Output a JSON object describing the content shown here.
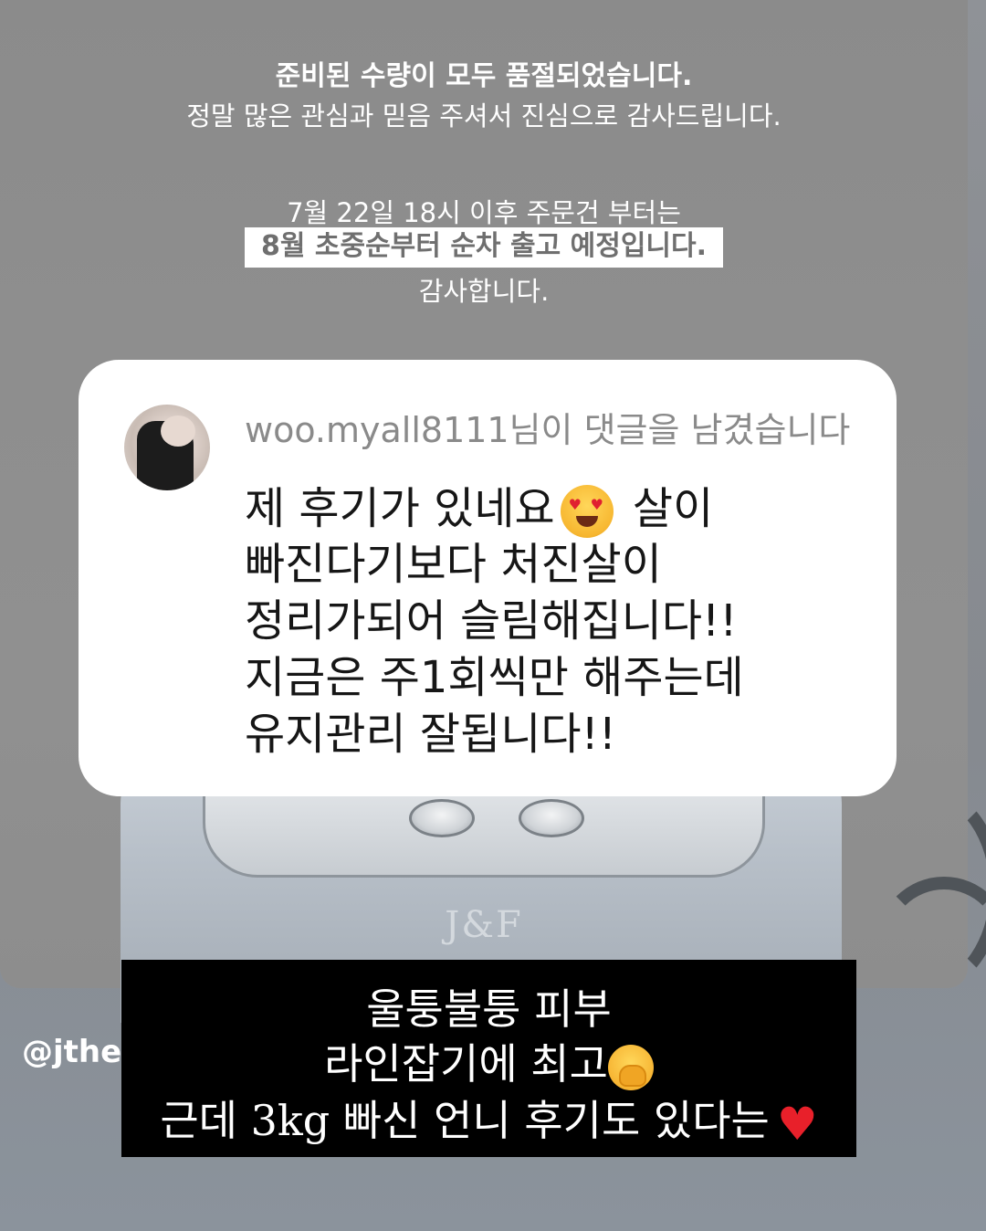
{
  "notice": {
    "line1": "준비된 수량이 모두 품절되었습니다.",
    "line2": "정말 많은 관심과 믿음 주셔서 진심으로 감사드립니다.",
    "line3": "7월 22일 18시 이후 주문건 부터는",
    "highlight": "8월 초중순부터 순차 출고 예정입니다.",
    "line5": "감사합니다."
  },
  "device": {
    "logo_text": "J&F"
  },
  "comment": {
    "header": "woo.myall8111님이 댓글을 남겼습니다",
    "lines": [
      "제 후기가 있네요",
      "살이",
      "빠진다기보다 처진살이",
      "정리가되어 슬림해집니다!!",
      "지금은 주1회씩만 해주는데",
      "유지관리 잘됩니다!!"
    ],
    "emoji_icon": "heart-eyes-emoji"
  },
  "handle": "@jthef",
  "caption": {
    "line1": "울퉁불퉁 피부",
    "line2": "라인잡기에 최고",
    "line3": "근데 3kg 빠신 언니 후기도 있다는",
    "emoji_icon": "hand-over-mouth-emoji",
    "heart_icon": "red-heart-emoji"
  },
  "colors": {
    "caption_bg": "#000000",
    "highlight_bg": "#ffffff",
    "card_bg": "#ffffff"
  }
}
